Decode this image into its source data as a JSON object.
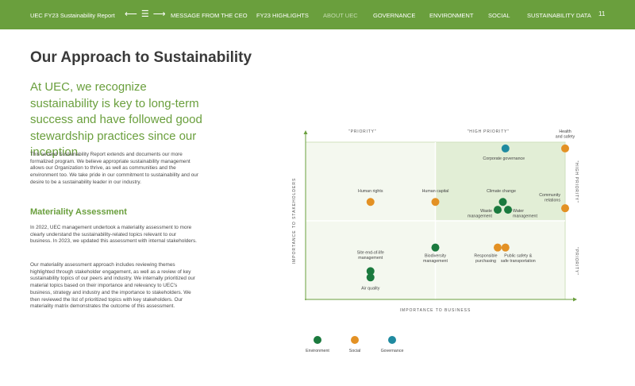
{
  "nav": {
    "brand": "UEC FY23 Sustainability Report",
    "arrows": "⟵ ☰ ⟶",
    "items": [
      "MESSAGE FROM THE CEO",
      "FY23 HIGHLIGHTS",
      "ABOUT UEC",
      "GOVERNANCE",
      "ENVIRONMENT",
      "SOCIAL",
      "SUSTAINABILITY DATA"
    ],
    "active": "ABOUT UEC",
    "page_number": "11"
  },
  "page": {
    "title": "Our Approach to Sustainability",
    "intro": "At UEC, we recognize sustainability is key to long-term success and have followed good stewardship practices since our inception.",
    "paragraph1": "This second Sustainability Report extends and documents our more formalized program. We believe appropriate sustainability management allows our Organization to thrive, as well as communities and the environment too. We take pride in our commitment to sustainability and our desire to be a sustainability leader in our industry.",
    "section_heading": "Materiality Assessment",
    "paragraph2": "In 2022, UEC management undertook a materiality assessment to more clearly understand the sustainability-related topics relevant to our business. In 2023, we updated this assessment with internal stakeholders.",
    "paragraph3": "Our materiality assessment approach includes reviewing themes highlighted through stakeholder engagement, as well as a review of key sustainability topics of our peers and industry. We internally prioritized our material topics based on their importance and relevancy to UEC's business, strategy and industry and the importance to stakeholders. We then reviewed the list of prioritized topics with key stakeholders. Our materiality matrix demonstrates the outcome of this assessment."
  },
  "chart_data": {
    "type": "scatter",
    "title": "",
    "xlabel": "IMPORTANCE TO BUSINESS",
    "ylabel": "IMPORTANCE TO STAKEHOLDERS",
    "xlim": [
      0,
      10
    ],
    "ylim": [
      0,
      10
    ],
    "zone_labels": {
      "priority_top": "\"PRIORITY\"",
      "high_priority_top": "\"HIGH PRIORITY\"",
      "high_priority_right": "\"HIGH PRIORITY\"",
      "priority_right": "\"PRIORITY\""
    },
    "colors": {
      "Environment": "#1b7a3e",
      "Social": "#e39124",
      "Governance": "#1f8aa0"
    },
    "legend": [
      "Environment",
      "Social",
      "Governance"
    ],
    "legend_placement": "bottom",
    "points": [
      {
        "label": "Health\nand safety",
        "category": "Social",
        "x": 10.0,
        "y": 9.6
      },
      {
        "label": "Corporate governance",
        "category": "Governance",
        "x": 7.7,
        "y": 9.6
      },
      {
        "label": "Human rights",
        "category": "Social",
        "x": 2.5,
        "y": 6.2
      },
      {
        "label": "Human capital",
        "category": "Social",
        "x": 5.0,
        "y": 6.2
      },
      {
        "label": "Climate change",
        "category": "Environment",
        "x": 7.6,
        "y": 6.2
      },
      {
        "label": "Waste\nmanagement",
        "category": "Environment",
        "x": 7.4,
        "y": 5.7
      },
      {
        "label": "Water\nmanagement",
        "category": "Environment",
        "x": 7.8,
        "y": 5.7
      },
      {
        "label": "Community\nrelations",
        "category": "Social",
        "x": 10.0,
        "y": 5.8
      },
      {
        "label": "Biodiversity\nmanagement",
        "category": "Environment",
        "x": 5.0,
        "y": 3.3
      },
      {
        "label": "Responsible\npurchasing",
        "category": "Social",
        "x": 7.4,
        "y": 3.3
      },
      {
        "label": "Public safety &\nsafe transportation",
        "category": "Social",
        "x": 7.7,
        "y": 3.3
      },
      {
        "label": "Site end-of-life\nmanagement",
        "category": "Environment",
        "x": 2.5,
        "y": 1.8
      },
      {
        "label": "Air quality",
        "category": "Environment",
        "x": 2.5,
        "y": 1.4
      }
    ]
  }
}
